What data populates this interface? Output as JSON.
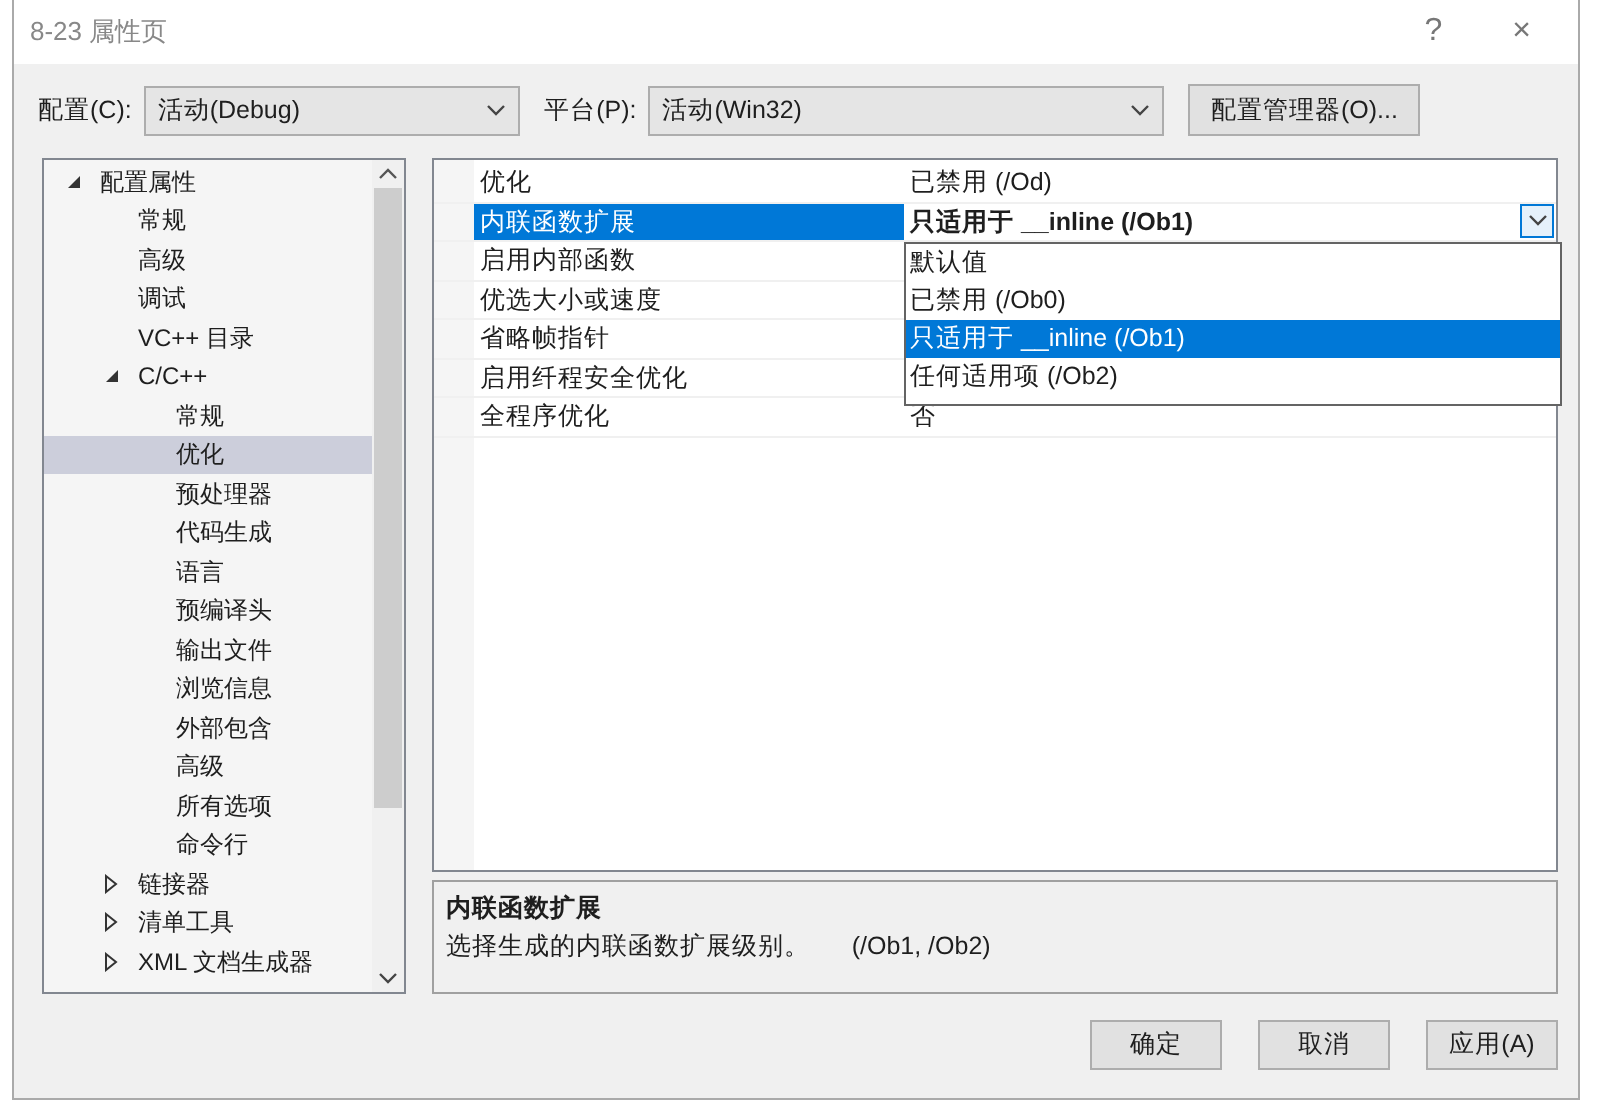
{
  "window": {
    "title": "8-23 属性页",
    "help": "?",
    "close": "×"
  },
  "toolbar": {
    "config_label": "配置(C):",
    "config_value": "活动(Debug)",
    "platform_label": "平台(P):",
    "platform_value": "活动(Win32)",
    "manager_button": "配置管理器(O)..."
  },
  "tree": [
    {
      "label": "配置属性",
      "expanded": true,
      "selected": false,
      "children": [
        {
          "label": "常规",
          "selected": false
        },
        {
          "label": "高级",
          "selected": false
        },
        {
          "label": "调试",
          "selected": false
        },
        {
          "label": "VC++ 目录",
          "selected": false
        },
        {
          "label": "C/C++",
          "expanded": true,
          "selected": false,
          "children": [
            {
              "label": "常规",
              "selected": false
            },
            {
              "label": "优化",
              "selected": true
            },
            {
              "label": "预处理器",
              "selected": false
            },
            {
              "label": "代码生成",
              "selected": false
            },
            {
              "label": "语言",
              "selected": false
            },
            {
              "label": "预编译头",
              "selected": false
            },
            {
              "label": "输出文件",
              "selected": false
            },
            {
              "label": "浏览信息",
              "selected": false
            },
            {
              "label": "外部包含",
              "selected": false
            },
            {
              "label": "高级",
              "selected": false
            },
            {
              "label": "所有选项",
              "selected": false
            },
            {
              "label": "命令行",
              "selected": false
            }
          ]
        },
        {
          "label": "链接器",
          "expanded": false,
          "selected": false
        },
        {
          "label": "清单工具",
          "expanded": false,
          "selected": false
        },
        {
          "label": "XML 文档生成器",
          "expanded": false,
          "selected": false
        }
      ]
    }
  ],
  "properties": [
    {
      "name": "优化",
      "value": "已禁用 (/Od)",
      "selected": false
    },
    {
      "name": "内联函数扩展",
      "value": "只适用于 __inline (/Ob1)",
      "selected": true
    },
    {
      "name": "启用内部函数",
      "selected": false
    },
    {
      "name": "优选大小或速度",
      "selected": false
    },
    {
      "name": "省略帧指针",
      "selected": false
    },
    {
      "name": "启用纤程安全优化",
      "selected": false
    },
    {
      "name": "全程序优化",
      "value": "否",
      "selected": false
    }
  ],
  "dropdown": {
    "options": [
      {
        "label": "默认值",
        "selected": false
      },
      {
        "label": "已禁用 (/Ob0)",
        "selected": false
      },
      {
        "label": "只适用于 __inline (/Ob1)",
        "selected": true
      },
      {
        "label": "任何适用项 (/Ob2)",
        "selected": false
      }
    ]
  },
  "description": {
    "title": "内联函数扩展",
    "text": "选择生成的内联函数扩展级别。      (/Ob1, /Ob2)"
  },
  "buttons": [
    "确定",
    "取消",
    "应用(A)"
  ]
}
